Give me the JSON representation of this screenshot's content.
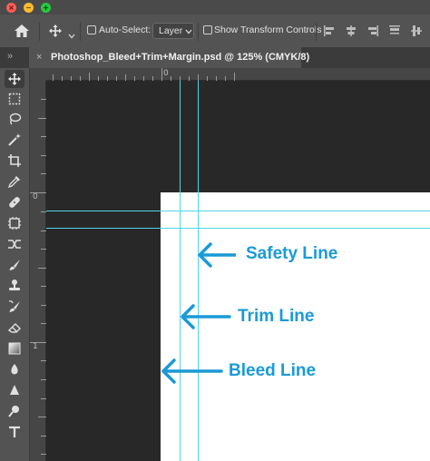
{
  "window": {
    "traffic_lights": {
      "close": "#ff5f57",
      "minimize": "#febc2e",
      "zoom": "#28c840"
    }
  },
  "options_bar": {
    "home_icon": "home-icon",
    "move_tool_icon": "move-tool-icon",
    "auto_select_label": "Auto-Select:",
    "auto_select_value": "Layer",
    "show_transform_label": "Show Transform Controls",
    "align_icons": [
      "align-left-icon",
      "align-center-icon",
      "align-right-icon",
      "align-top-icon",
      "align-middle-icon"
    ]
  },
  "document_tab": {
    "title": "Photoshop_Bleed+Trim+Margin.psd @ 125% (CMYK/8)",
    "close_glyph": "×"
  },
  "rulers": {
    "top_labels": [
      "0"
    ],
    "left_labels": [
      "0",
      "1"
    ]
  },
  "annotations": {
    "safety_line": "Safety Line",
    "trim_line": "Trim Line",
    "bleed_line": "Bleed Line",
    "color": "#1a9ad6"
  },
  "guide_color": "#4fd6e6",
  "tools": [
    "move-tool-icon",
    "marquee-tool-icon",
    "lasso-tool-icon",
    "magic-wand-icon",
    "crop-tool-icon",
    "eyedropper-icon",
    "healing-brush-icon",
    "patch-tool-icon",
    "content-aware-move-icon",
    "red-eye-icon",
    "brush-tool-icon",
    "stamp-tool-icon",
    "history-brush-icon",
    "eraser-tool-icon",
    "gradient-tool-icon",
    "blur-tool-icon",
    "sharpen-tool-icon",
    "dodge-tool-icon",
    "type-tool-icon"
  ]
}
